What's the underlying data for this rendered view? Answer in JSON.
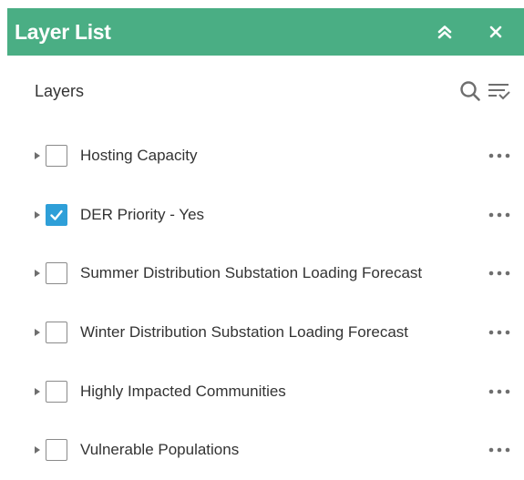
{
  "panel": {
    "title": "Layer List",
    "header_color": "#4aae84",
    "buttons": [
      {
        "name": "collapse-button",
        "icon": "double-chevron-up-icon"
      },
      {
        "name": "close-button",
        "icon": "close-icon"
      }
    ]
  },
  "toolbar": {
    "title": "Layers",
    "tools": [
      {
        "name": "search-button",
        "icon": "search-icon"
      },
      {
        "name": "filter-options-button",
        "icon": "filter-list-icon"
      }
    ]
  },
  "layers": [
    {
      "label": "Hosting Capacity",
      "checked": false
    },
    {
      "label": "DER Priority - Yes",
      "checked": true
    },
    {
      "label": "Summer Distribution Substation Loading Forecast",
      "checked": false
    },
    {
      "label": "Winter Distribution Substation Loading Forecast",
      "checked": false
    },
    {
      "label": "Highly Impacted Communities",
      "checked": false
    },
    {
      "label": "Vulnerable Populations",
      "checked": false
    }
  ],
  "colors": {
    "accent": "#4aae84",
    "checkbox_checked": "#2e9fd8",
    "icon_gray": "#6e6e6e"
  }
}
